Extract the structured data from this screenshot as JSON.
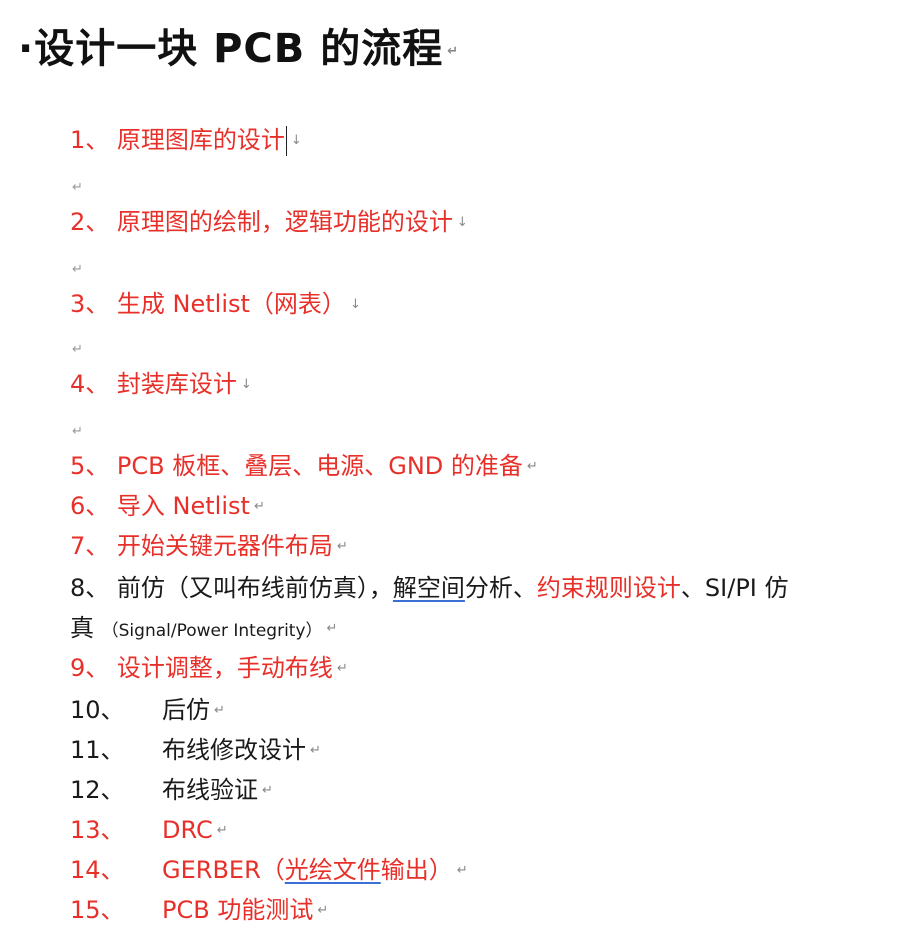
{
  "title": {
    "text": "·设计一块 PCB 的流程",
    "mark": "↵"
  },
  "empty_mark": "↵",
  "steps": [
    {
      "num": "1、",
      "text": "原理图库的设计",
      "mark": "↓"
    },
    {
      "num": "2、",
      "text": "原理图的绘制，逻辑功能的设计",
      "mark": "↓"
    },
    {
      "num": "3、",
      "text": "生成 Netlist（网表）",
      "mark": "↓"
    },
    {
      "num": "4、",
      "text": "封装库设计",
      "mark": "↓"
    },
    {
      "num": "5、",
      "text": "PCB 板框、叠层、电源、GND 的准备",
      "mark": "↵"
    },
    {
      "num": "6、",
      "text": "导入 Netlist",
      "mark": "↵"
    },
    {
      "num": "7、",
      "text": "开始关键元器件布局",
      "mark": "↵"
    },
    {
      "num": "8、",
      "parts": [
        "前仿（又叫布线前仿真），",
        "解空间",
        "分析、",
        "约束规则设计",
        "、SI/PI 仿"
      ],
      "cont": "真",
      "cont_small": "（Signal/Power Integrity）",
      "mark": "↵"
    },
    {
      "num": "9、",
      "text": "设计调整，手动布线",
      "mark": "↵"
    },
    {
      "num": "10、",
      "text": "后仿",
      "mark": "↵"
    },
    {
      "num": "11、",
      "text": "布线修改设计",
      "mark": "↵"
    },
    {
      "num": "12、",
      "text": "布线验证",
      "mark": "↵"
    },
    {
      "num": "13、",
      "text": "DRC",
      "mark": "↵"
    },
    {
      "num": "14、",
      "parts": [
        "GERBER（",
        "光绘文件",
        "输出）"
      ],
      "mark": "↵"
    },
    {
      "num": "15、",
      "text": "PCB 功能测试",
      "mark": "↵"
    }
  ],
  "colors": {
    "highlight": "#e8302a",
    "normal": "#1a1a1a",
    "underline": "#3b6fd4"
  }
}
